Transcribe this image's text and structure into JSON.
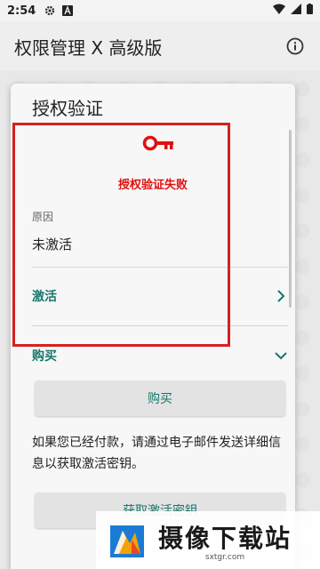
{
  "status_bar": {
    "time": "2:54",
    "icons": [
      "gear-icon",
      "a-icon",
      "wifi-icon",
      "signal-icon",
      "battery-icon"
    ]
  },
  "app_bar": {
    "title": "权限管理 X 高级版",
    "info_icon": "info-icon"
  },
  "dialog": {
    "title": "授权验证",
    "status_icon": "key-icon",
    "status_text": "授权验证失败",
    "reason_label": "原因",
    "reason_value": "未激活",
    "activate_label": "激活",
    "purchase_label": "购买",
    "purchase_button": "购买",
    "info_text": "如果您已经付款，请通过电子邮件发送详细信息以获取激活密钥。",
    "get_key_button": "获取激活密钥"
  },
  "watermark": {
    "main": "摄像下载站",
    "sub": "sxtgr.com"
  },
  "colors": {
    "accent": "#17776d",
    "error": "#e01010",
    "highlight": "#d62020"
  }
}
